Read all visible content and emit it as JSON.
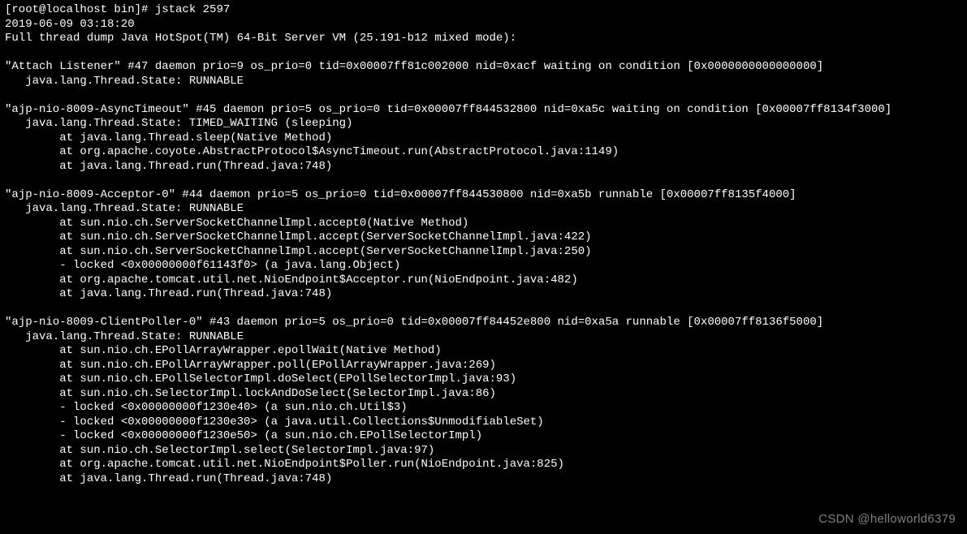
{
  "terminal": {
    "prompt": "[root@localhost bin]# jstack 2597",
    "timestamp": "2019-06-09 03:18:20",
    "header": "Full thread dump Java HotSpot(TM) 64-Bit Server VM (25.191-b12 mixed mode):",
    "threads": [
      {
        "title": "\"Attach Listener\" #47 daemon prio=9 os_prio=0 tid=0x00007ff81c002000 nid=0xacf waiting on condition [0x0000000000000000]",
        "state": "   java.lang.Thread.State: RUNNABLE",
        "stack": []
      },
      {
        "title": "\"ajp-nio-8009-AsyncTimeout\" #45 daemon prio=5 os_prio=0 tid=0x00007ff844532800 nid=0xa5c waiting on condition [0x00007ff8134f3000]",
        "state": "   java.lang.Thread.State: TIMED_WAITING (sleeping)",
        "stack": [
          "        at java.lang.Thread.sleep(Native Method)",
          "        at org.apache.coyote.AbstractProtocol$AsyncTimeout.run(AbstractProtocol.java:1149)",
          "        at java.lang.Thread.run(Thread.java:748)"
        ]
      },
      {
        "title": "\"ajp-nio-8009-Acceptor-0\" #44 daemon prio=5 os_prio=0 tid=0x00007ff844530800 nid=0xa5b runnable [0x00007ff8135f4000]",
        "state": "   java.lang.Thread.State: RUNNABLE",
        "stack": [
          "        at sun.nio.ch.ServerSocketChannelImpl.accept0(Native Method)",
          "        at sun.nio.ch.ServerSocketChannelImpl.accept(ServerSocketChannelImpl.java:422)",
          "        at sun.nio.ch.ServerSocketChannelImpl.accept(ServerSocketChannelImpl.java:250)",
          "        - locked <0x00000000f61143f0> (a java.lang.Object)",
          "        at org.apache.tomcat.util.net.NioEndpoint$Acceptor.run(NioEndpoint.java:482)",
          "        at java.lang.Thread.run(Thread.java:748)"
        ]
      },
      {
        "title": "\"ajp-nio-8009-ClientPoller-0\" #43 daemon prio=5 os_prio=0 tid=0x00007ff84452e800 nid=0xa5a runnable [0x00007ff8136f5000]",
        "state": "   java.lang.Thread.State: RUNNABLE",
        "stack": [
          "        at sun.nio.ch.EPollArrayWrapper.epollWait(Native Method)",
          "        at sun.nio.ch.EPollArrayWrapper.poll(EPollArrayWrapper.java:269)",
          "        at sun.nio.ch.EPollSelectorImpl.doSelect(EPollSelectorImpl.java:93)",
          "        at sun.nio.ch.SelectorImpl.lockAndDoSelect(SelectorImpl.java:86)",
          "        - locked <0x00000000f1230e40> (a sun.nio.ch.Util$3)",
          "        - locked <0x00000000f1230e30> (a java.util.Collections$UnmodifiableSet)",
          "        - locked <0x00000000f1230e50> (a sun.nio.ch.EPollSelectorImpl)",
          "        at sun.nio.ch.SelectorImpl.select(SelectorImpl.java:97)",
          "        at org.apache.tomcat.util.net.NioEndpoint$Poller.run(NioEndpoint.java:825)",
          "        at java.lang.Thread.run(Thread.java:748)"
        ]
      }
    ]
  },
  "watermark": "CSDN @helloworld6379"
}
